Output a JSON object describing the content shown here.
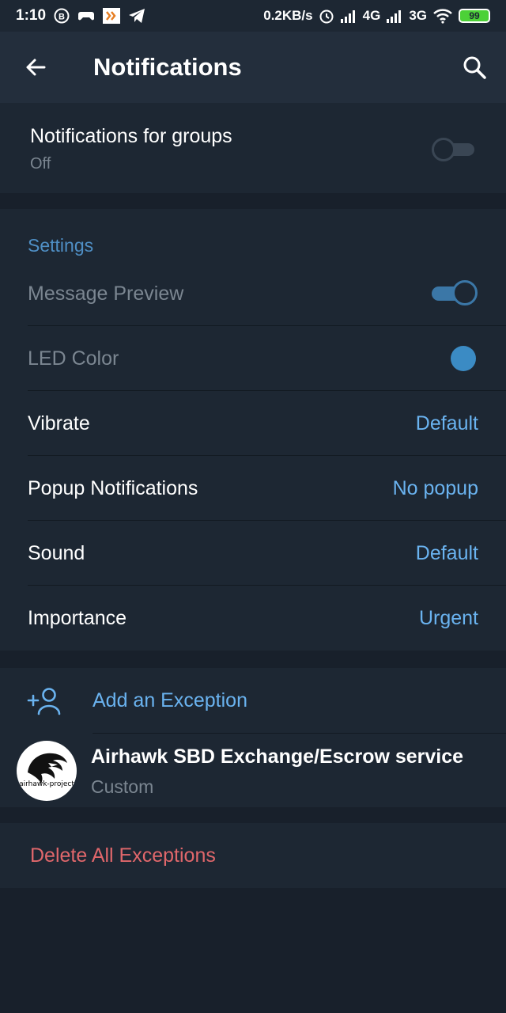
{
  "status_bar": {
    "time": "1:10",
    "network_speed": "0.2KB/s",
    "signal_1": "4G",
    "signal_2": "3G",
    "battery": "99"
  },
  "app_bar": {
    "title": "Notifications",
    "back_icon": "arrow-left-icon",
    "search_icon": "search-icon"
  },
  "groups": {
    "title": "Notifications for groups",
    "status": "Off",
    "enabled": false
  },
  "settings": {
    "header": "Settings",
    "message_preview": {
      "label": "Message Preview",
      "enabled": true
    },
    "led_color": {
      "label": "LED Color",
      "color": "#3b8bc4"
    },
    "vibrate": {
      "label": "Vibrate",
      "value": "Default"
    },
    "popup": {
      "label": "Popup Notifications",
      "value": "No popup"
    },
    "sound": {
      "label": "Sound",
      "value": "Default"
    },
    "importance": {
      "label": "Importance",
      "value": "Urgent"
    }
  },
  "exceptions": {
    "add_label": "Add an Exception",
    "items": [
      {
        "name": "Airhawk SBD Exchange/Escrow service",
        "status": "Custom",
        "avatar_text": "airhawk-project"
      }
    ]
  },
  "delete_all": {
    "label": "Delete All Exceptions"
  },
  "colors": {
    "accent": "#6ab3f0",
    "danger": "#e0676b",
    "background": "#18202b",
    "card": "#1d2733"
  }
}
